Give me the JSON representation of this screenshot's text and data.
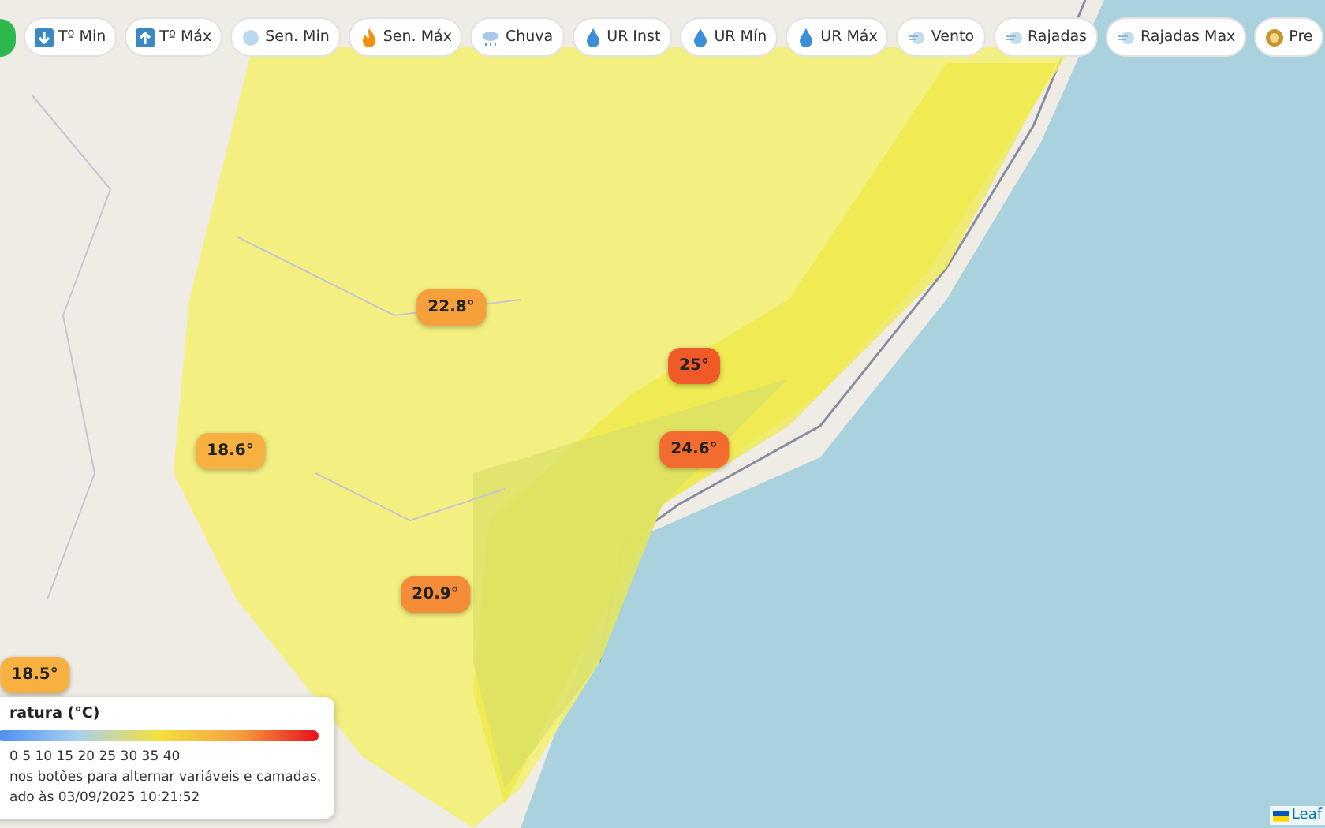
{
  "toolbar": {
    "buttons": [
      {
        "kind": "tmin",
        "label": "Tº Min"
      },
      {
        "kind": "tmax",
        "label": "Tº Máx"
      },
      {
        "kind": "cold",
        "label": "Sen. Min"
      },
      {
        "kind": "hot",
        "label": "Sen. Máx"
      },
      {
        "kind": "rain",
        "label": "Chuva"
      },
      {
        "kind": "drop",
        "label": "UR Inst"
      },
      {
        "kind": "drop",
        "label": "UR Mín"
      },
      {
        "kind": "drop",
        "label": "UR Máx"
      },
      {
        "kind": "wind",
        "label": "Vento"
      },
      {
        "kind": "wind",
        "label": "Rajadas"
      },
      {
        "kind": "wind",
        "label": "Rajadas Max"
      },
      {
        "kind": "gauge",
        "label": "Pre"
      }
    ]
  },
  "markers": [
    {
      "label": "22.8°",
      "color": "#f6a03c"
    },
    {
      "label": "25°",
      "color": "#f05a28"
    },
    {
      "label": "24.6°",
      "color": "#f26c30"
    },
    {
      "label": "18.6°",
      "color": "#f8b040"
    },
    {
      "label": "20.9°",
      "color": "#f58c38"
    },
    {
      "label": "18.5°",
      "color": "#f8b040"
    }
  ],
  "legend": {
    "title": "ratura (°C)",
    "scale": "0 5 10 15 20 25 30 35 40",
    "lines": [
      "nos botões para alternar variáveis e camadas.",
      "ado às 03/09/2025 10:21:52"
    ]
  },
  "attribution": "Leaf"
}
